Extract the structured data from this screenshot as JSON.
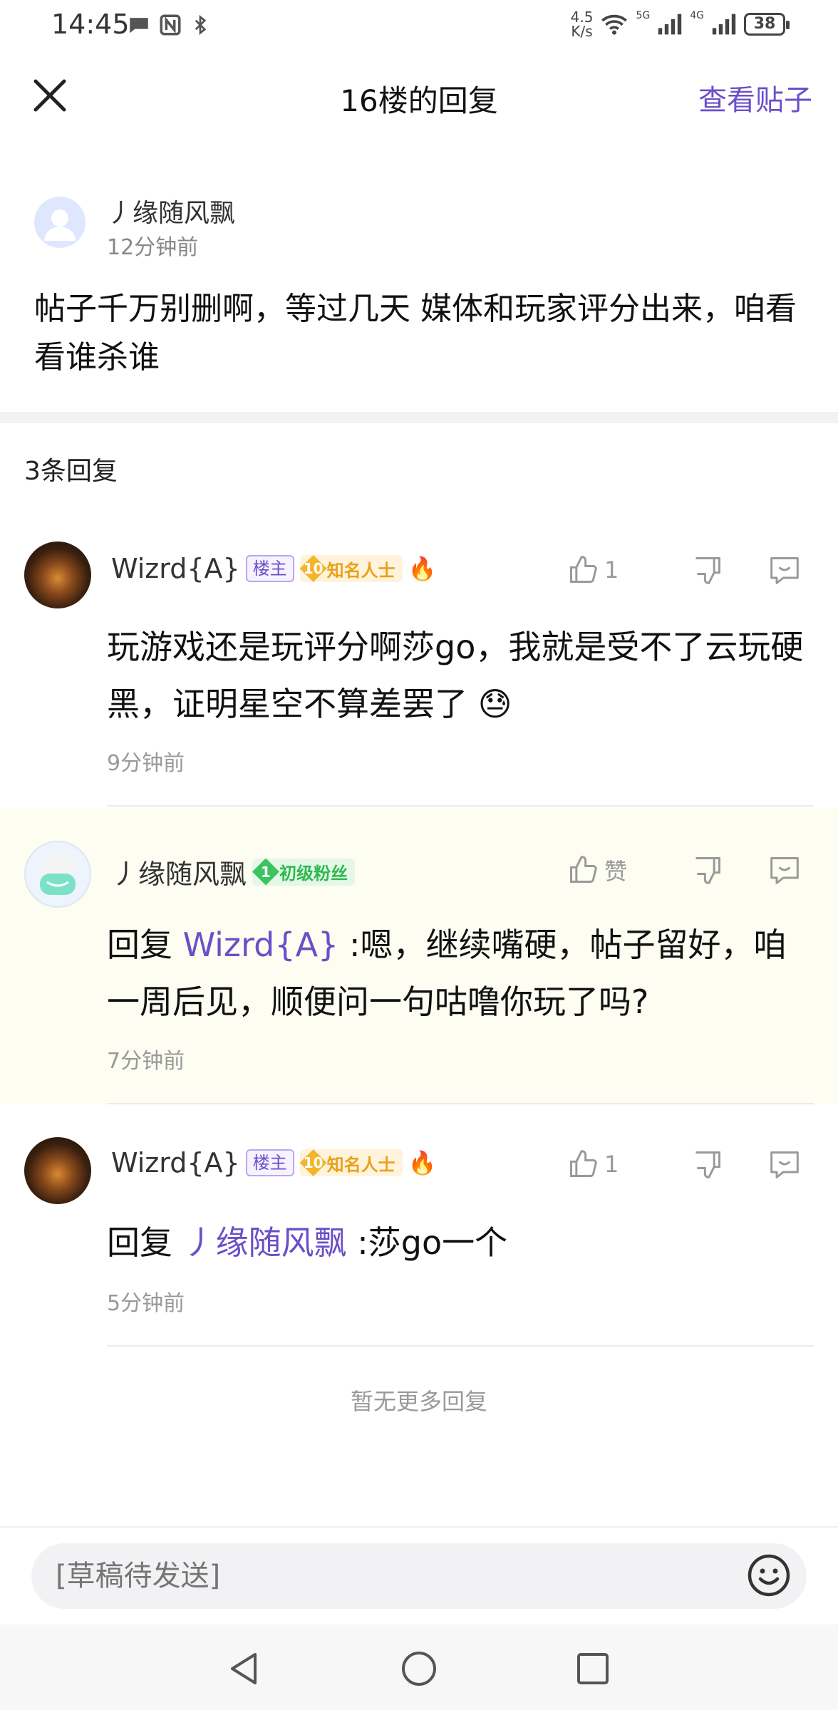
{
  "status_bar": {
    "time": "14:45",
    "net_speed": "4.5\nK/s",
    "net_speed_top": "4.5",
    "net_speed_bottom": "K/s",
    "sig1": "5G",
    "sig2": "4G",
    "battery": "38"
  },
  "header": {
    "title": "16楼的回复",
    "view_post": "查看贴子"
  },
  "original_post": {
    "author": "丿缘随风飘",
    "time": "12分钟前",
    "content": "帖子千万别删啊，等过几天 媒体和玩家评分出来，咱看看谁杀谁"
  },
  "reply_count": "3条回复",
  "replies": [
    {
      "author": "Wizrd{A}",
      "owner_badge": "楼主",
      "level": "10",
      "level_title": "知名人士",
      "likes": "1",
      "content": "玩游戏还是玩评分啊莎go，我就是受不了云玩硬黑，证明星空不算差罢了",
      "emoji": "😓",
      "time": "9分钟前"
    },
    {
      "author": "丿缘随风飘",
      "level": "1",
      "level_title": "初级粉丝",
      "likes": "赞",
      "reply_prefix": "回复",
      "mention": "Wizrd{A}",
      "content": ":嗯，继续嘴硬，帖子留好，咱一周后见，顺便问一句咕噜你玩了吗?",
      "time": "7分钟前"
    },
    {
      "author": "Wizrd{A}",
      "owner_badge": "楼主",
      "level": "10",
      "level_title": "知名人士",
      "likes": "1",
      "reply_prefix": "回复",
      "mention": "丿缘随风飘",
      "content": ":莎go一个",
      "time": "5分钟前"
    }
  ],
  "no_more": "暂无更多回复",
  "input": {
    "placeholder": "[草稿待发送]"
  },
  "colors": {
    "accent": "#6a4fc8",
    "highlight_bg": "#fdfdf2"
  }
}
